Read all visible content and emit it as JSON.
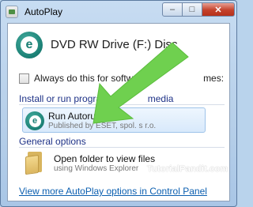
{
  "window": {
    "title": "AutoPlay",
    "minimize_glyph": "–",
    "maximize_glyph": "□",
    "close_glyph": "✕"
  },
  "drive": {
    "icon": "eset-logo",
    "label": "DVD RW Drive (F:) Disc"
  },
  "always_checkbox": {
    "checked": false,
    "label": "Always do this for softwa",
    "label_tail": "mes:"
  },
  "sections": {
    "install": "Install or run program fr",
    "install_tail": "media",
    "general": "General options"
  },
  "options": {
    "run": {
      "icon": "eset-logo",
      "title": "Run Autorun.exe",
      "subtitle": "Published by ESET, spol. s r.o."
    },
    "open_folder": {
      "icon": "folder-icon",
      "title": "Open folder to view files",
      "subtitle": "using Windows Explorer"
    }
  },
  "watermark": "TutorialPandit.com",
  "more_link": "View more AutoPlay options in Control Panel",
  "colors": {
    "arrow_green": "#6fd04f",
    "link_blue": "#0b5fb0",
    "header_blue": "#1e3287",
    "eset_teal": "#1a7f74"
  }
}
